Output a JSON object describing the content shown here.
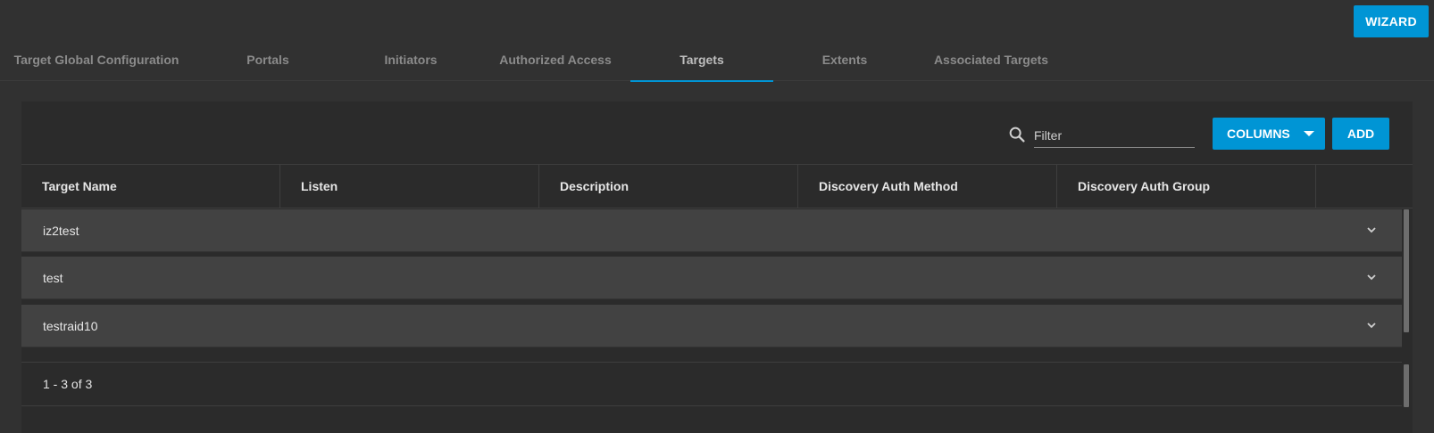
{
  "header": {
    "wizard_label": "WIZARD"
  },
  "tabs": [
    {
      "label": "Target Global Configuration"
    },
    {
      "label": "Portals"
    },
    {
      "label": "Initiators"
    },
    {
      "label": "Authorized Access"
    },
    {
      "label": "Targets",
      "active": true
    },
    {
      "label": "Extents"
    },
    {
      "label": "Associated Targets"
    }
  ],
  "toolbar": {
    "filter_placeholder": "Filter",
    "columns_label": "COLUMNS",
    "add_label": "ADD"
  },
  "table": {
    "columns": [
      "Target Name",
      "Listen",
      "Description",
      "Discovery Auth Method",
      "Discovery Auth Group"
    ],
    "rows": [
      {
        "name": "iz2test"
      },
      {
        "name": "test"
      },
      {
        "name": "testraid10"
      }
    ]
  },
  "pagination": {
    "summary": "1 - 3 of 3"
  },
  "icons": {
    "search": "search-icon",
    "expand": "chevron-down-icon",
    "dropdown": "caret-down-icon"
  },
  "colors": {
    "accent": "#0095d5",
    "background": "#313131",
    "card": "#2b2b2b",
    "row": "#424242"
  }
}
